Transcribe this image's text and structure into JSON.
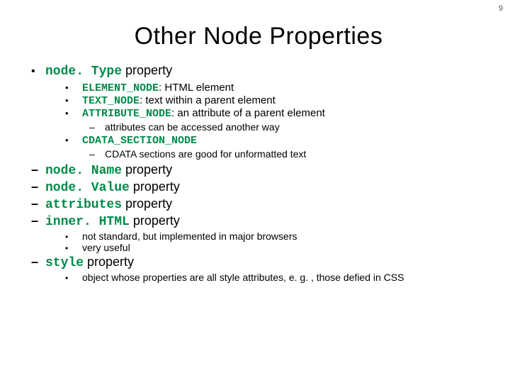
{
  "page_number": "9",
  "title": "Other Node Properties",
  "items": [
    {
      "marker": "bullet",
      "code": "node. Type",
      "text": " property",
      "sub": [
        {
          "code": "ELEMENT_NODE",
          "text": ": HTML element"
        },
        {
          "code": "TEXT_NODE",
          "text": ": text within a parent element"
        },
        {
          "code": "ATTRIBUTE_NODE",
          "text": ": an attribute of a parent element",
          "sub": [
            {
              "text": "attributes can be accessed another way"
            }
          ]
        },
        {
          "code": "CDATA_SECTION_NODE",
          "text": "",
          "sub": [
            {
              "text": "CDATA sections are good for unformatted text"
            }
          ]
        }
      ]
    },
    {
      "marker": "dash",
      "code": "node. Name",
      "text": " property"
    },
    {
      "marker": "dash",
      "code": "node. Value",
      "text": " property"
    },
    {
      "marker": "dash",
      "code": "attributes",
      "text": " property"
    },
    {
      "marker": "dash",
      "code": "inner. HTML",
      "text": " property",
      "sub2": [
        {
          "text": "not standard, but implemented in major browsers"
        },
        {
          "text": "very useful"
        }
      ]
    },
    {
      "marker": "dash",
      "code": "style",
      "text": " property",
      "sub2": [
        {
          "text": "object whose properties are all style attributes,  e. g. , those defied in CSS"
        }
      ]
    }
  ]
}
